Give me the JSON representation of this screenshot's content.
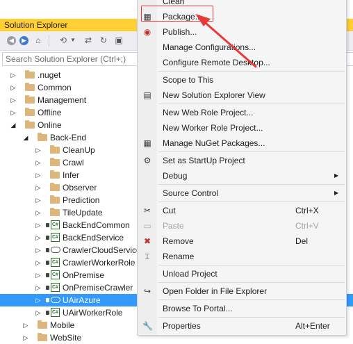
{
  "solution_explorer": {
    "title": "Solution Explorer",
    "search_placeholder": "Search Solution Explorer (Ctrl+;)",
    "tree": [
      {
        "label": ".nuget",
        "kind": "folder",
        "expanded": false
      },
      {
        "label": "Common",
        "kind": "folder",
        "expanded": false
      },
      {
        "label": "Management",
        "kind": "folder",
        "expanded": false
      },
      {
        "label": "Offline",
        "kind": "folder",
        "expanded": false
      },
      {
        "label": "Online",
        "kind": "folder",
        "expanded": true
      },
      {
        "label": "Back-End",
        "kind": "folder",
        "expanded": true
      },
      {
        "label": "CleanUp",
        "kind": "folder",
        "expanded": false
      },
      {
        "label": "Crawl",
        "kind": "folder",
        "expanded": false
      },
      {
        "label": "Infer",
        "kind": "folder",
        "expanded": false
      },
      {
        "label": "Observer",
        "kind": "folder",
        "expanded": false
      },
      {
        "label": "Prediction",
        "kind": "folder",
        "expanded": false
      },
      {
        "label": "TileUpdate",
        "kind": "folder",
        "expanded": false
      },
      {
        "label": "BackEndCommon",
        "kind": "csharp",
        "expanded": false
      },
      {
        "label": "BackEndService",
        "kind": "csharp",
        "expanded": false
      },
      {
        "label": "CrawlerCloudService",
        "kind": "cloud",
        "expanded": false
      },
      {
        "label": "CrawlerWorkerRole",
        "kind": "csharp",
        "expanded": false
      },
      {
        "label": "OnPremise",
        "kind": "csharp",
        "expanded": false
      },
      {
        "label": "OnPremiseCrawler",
        "kind": "csharp",
        "expanded": false
      },
      {
        "label": "UAirAzure",
        "kind": "cloud",
        "expanded": false,
        "selected": true
      },
      {
        "label": "UAirWorkerRole",
        "kind": "csharp",
        "expanded": false
      },
      {
        "label": "Mobile",
        "kind": "folder",
        "expanded": false
      },
      {
        "label": "WebSite",
        "kind": "folder",
        "expanded": false
      }
    ]
  },
  "context_menu": {
    "items": [
      {
        "label": "Clean",
        "shortcut": "",
        "icon": "",
        "submenu": false
      },
      {
        "label": "Package...",
        "shortcut": "",
        "icon": "package-icon",
        "submenu": false,
        "highlighted": true
      },
      {
        "label": "Publish...",
        "shortcut": "",
        "icon": "publish-icon",
        "submenu": false
      },
      {
        "label": "Manage Configurations...",
        "shortcut": "",
        "icon": "",
        "submenu": false
      },
      {
        "label": "Configure Remote Desktop...",
        "shortcut": "",
        "icon": "",
        "submenu": false
      },
      {
        "sep": true
      },
      {
        "label": "Scope to This",
        "shortcut": "",
        "icon": "",
        "submenu": false
      },
      {
        "label": "New Solution Explorer View",
        "shortcut": "",
        "icon": "new-view-icon",
        "submenu": false
      },
      {
        "sep": true
      },
      {
        "label": "New Web Role Project...",
        "shortcut": "",
        "icon": "",
        "submenu": false
      },
      {
        "label": "New Worker Role Project...",
        "shortcut": "",
        "icon": "",
        "submenu": false
      },
      {
        "label": "Manage NuGet Packages...",
        "shortcut": "",
        "icon": "nuget-icon",
        "submenu": false
      },
      {
        "sep": true
      },
      {
        "label": "Set as StartUp Project",
        "shortcut": "",
        "icon": "gear-icon",
        "submenu": false
      },
      {
        "label": "Debug",
        "shortcut": "",
        "icon": "",
        "submenu": true
      },
      {
        "sep": true
      },
      {
        "label": "Source Control",
        "shortcut": "",
        "icon": "",
        "submenu": true
      },
      {
        "sep": true
      },
      {
        "label": "Cut",
        "shortcut": "Ctrl+X",
        "icon": "cut-icon",
        "submenu": false
      },
      {
        "label": "Paste",
        "shortcut": "Ctrl+V",
        "icon": "paste-icon",
        "submenu": false,
        "disabled": true
      },
      {
        "label": "Remove",
        "shortcut": "Del",
        "icon": "remove-icon",
        "submenu": false
      },
      {
        "label": "Rename",
        "shortcut": "",
        "icon": "rename-icon",
        "submenu": false
      },
      {
        "sep": true
      },
      {
        "label": "Unload Project",
        "shortcut": "",
        "icon": "",
        "submenu": false
      },
      {
        "sep": true
      },
      {
        "label": "Open Folder in File Explorer",
        "shortcut": "",
        "icon": "open-folder-icon",
        "submenu": false
      },
      {
        "sep": true
      },
      {
        "label": "Browse To Portal...",
        "shortcut": "",
        "icon": "",
        "submenu": false
      },
      {
        "sep": true
      },
      {
        "label": "Properties",
        "shortcut": "Alt+Enter",
        "icon": "wrench-icon",
        "submenu": false
      }
    ]
  },
  "colors": {
    "title_bar": "#ffcf33",
    "selection": "#3399ff",
    "annotation": "#e8393a"
  }
}
